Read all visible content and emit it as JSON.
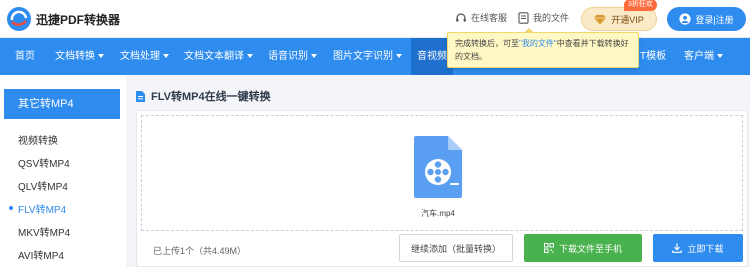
{
  "header": {
    "brand": "迅捷PDF转换器",
    "service_label": "在线客服",
    "files_label": "我的文件",
    "vip_label": "开通VIP",
    "vip_badge": "3折狂欢",
    "login_label": "登录|注册"
  },
  "nav": {
    "items": [
      {
        "label": "首页",
        "has_caret": false
      },
      {
        "label": "文档转换",
        "has_caret": true
      },
      {
        "label": "文档处理",
        "has_caret": true
      },
      {
        "label": "文档文本翻译",
        "has_caret": true
      },
      {
        "label": "语音识别",
        "has_caret": true
      },
      {
        "label": "图片文字识别",
        "has_caret": true
      },
      {
        "label": "音视频",
        "has_caret": false
      },
      {
        "label": "T模板",
        "has_caret": false
      },
      {
        "label": "客户端",
        "has_caret": true
      }
    ]
  },
  "tooltip": {
    "text_before": "完成转换后，可至",
    "highlight": "\"我的文件\"",
    "text_after": "中查看并下载转换好的文档。"
  },
  "sidebar": {
    "header": "其它转MP4",
    "items": [
      {
        "label": "视频转换",
        "active": false
      },
      {
        "label": "QSV转MP4",
        "active": false
      },
      {
        "label": "QLV转MP4",
        "active": false
      },
      {
        "label": "FLV转MP4",
        "active": true
      },
      {
        "label": "MKV转MP4",
        "active": false
      },
      {
        "label": "AVI转MP4",
        "active": false
      }
    ]
  },
  "main": {
    "title": "FLV转MP4在线一键转换",
    "file_name": "汽车.mp4",
    "upload_count": "已上传1个（共4.49M）",
    "add_button": "继续添加（批量转换）",
    "phone_button": "下载文件至手机",
    "download_button": "立即下载"
  },
  "colors": {
    "primary": "#2f8cef",
    "nav_active": "#1f6fcf",
    "green": "#49b24f",
    "tooltip_bg": "#fff8c4"
  }
}
